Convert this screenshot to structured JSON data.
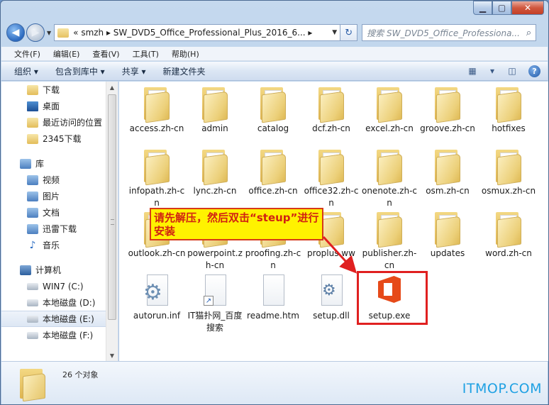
{
  "window": {
    "breadcrumb": "« smzh ▸ SW_DVD5_Office_Professional_Plus_2016_6... ▸",
    "search_placeholder": "搜索 SW_DVD5_Office_Professiona..."
  },
  "menubar": {
    "items": [
      "文件(F)",
      "编辑(E)",
      "查看(V)",
      "工具(T)",
      "帮助(H)"
    ]
  },
  "toolbar": {
    "organize": "组织 ▾",
    "include": "包含到库中 ▾",
    "share": "共享 ▾",
    "new_folder": "新建文件夹"
  },
  "nav": {
    "favorites": [
      "下载",
      "桌面",
      "最近访问的位置",
      "2345下载"
    ],
    "libraries_label": "库",
    "libraries": [
      "视频",
      "图片",
      "文档",
      "迅雷下载",
      "音乐"
    ],
    "computer_label": "计算机",
    "drives": [
      "WIN7 (C:)",
      "本地磁盘 (D:)",
      "本地磁盘 (E:)",
      "本地磁盘 (F:)"
    ]
  },
  "files": [
    {
      "name": "access.zh-cn",
      "kind": "folder"
    },
    {
      "name": "admin",
      "kind": "folder"
    },
    {
      "name": "catalog",
      "kind": "folder"
    },
    {
      "name": "dcf.zh-cn",
      "kind": "folder"
    },
    {
      "name": "excel.zh-cn",
      "kind": "folder"
    },
    {
      "name": "groove.zh-cn",
      "kind": "folder"
    },
    {
      "name": "hotfixes",
      "kind": "folder"
    },
    {
      "name": "infopath.zh-cn",
      "kind": "folder"
    },
    {
      "name": "lync.zh-cn",
      "kind": "folder"
    },
    {
      "name": "office.zh-cn",
      "kind": "folder"
    },
    {
      "name": "office32.zh-cn",
      "kind": "folder"
    },
    {
      "name": "onenote.zh-cn",
      "kind": "folder"
    },
    {
      "name": "osm.zh-cn",
      "kind": "folder"
    },
    {
      "name": "osmux.zh-cn",
      "kind": "folder"
    },
    {
      "name": "outlook.zh-cn",
      "kind": "folder"
    },
    {
      "name": "powerpoint.zh-cn",
      "kind": "folder"
    },
    {
      "name": "proofing.zh-cn",
      "kind": "folder"
    },
    {
      "name": "proplus.ww",
      "kind": "folder"
    },
    {
      "name": "publisher.zh-cn",
      "kind": "folder"
    },
    {
      "name": "updates",
      "kind": "folder"
    },
    {
      "name": "word.zh-cn",
      "kind": "folder"
    },
    {
      "name": "autorun.inf",
      "kind": "settings-file"
    },
    {
      "name": "IT猫扑网_百度搜索",
      "kind": "shortcut"
    },
    {
      "name": "readme.htm",
      "kind": "document"
    },
    {
      "name": "setup.dll",
      "kind": "dll"
    },
    {
      "name": "setup.exe",
      "kind": "office-exe"
    }
  ],
  "annotation": "请先解压，然后双击“steup”进行安装",
  "details": {
    "count": "26 个对象"
  },
  "watermark": "ITMOP.COM",
  "colors": {
    "highlight_border": "#e02020",
    "callout_fill": "#fff200",
    "office_orange": "#e64a19"
  }
}
